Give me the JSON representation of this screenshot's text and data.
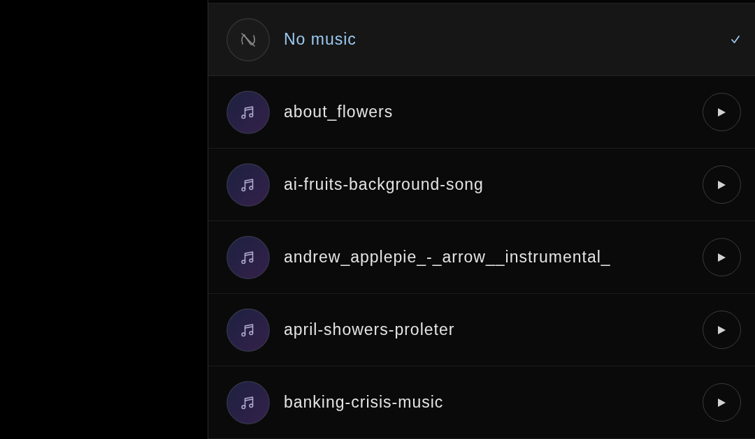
{
  "tracks": [
    {
      "kind": "none",
      "title": "No music",
      "selected": true
    },
    {
      "kind": "track",
      "title": "about_flowers",
      "selected": false
    },
    {
      "kind": "track",
      "title": "ai-fruits-background-song",
      "selected": false
    },
    {
      "kind": "track",
      "title": "andrew_applepie_-_arrow__instrumental_",
      "selected": false
    },
    {
      "kind": "track",
      "title": "april-showers-proleter",
      "selected": false
    },
    {
      "kind": "track",
      "title": "banking-crisis-music",
      "selected": false
    }
  ]
}
